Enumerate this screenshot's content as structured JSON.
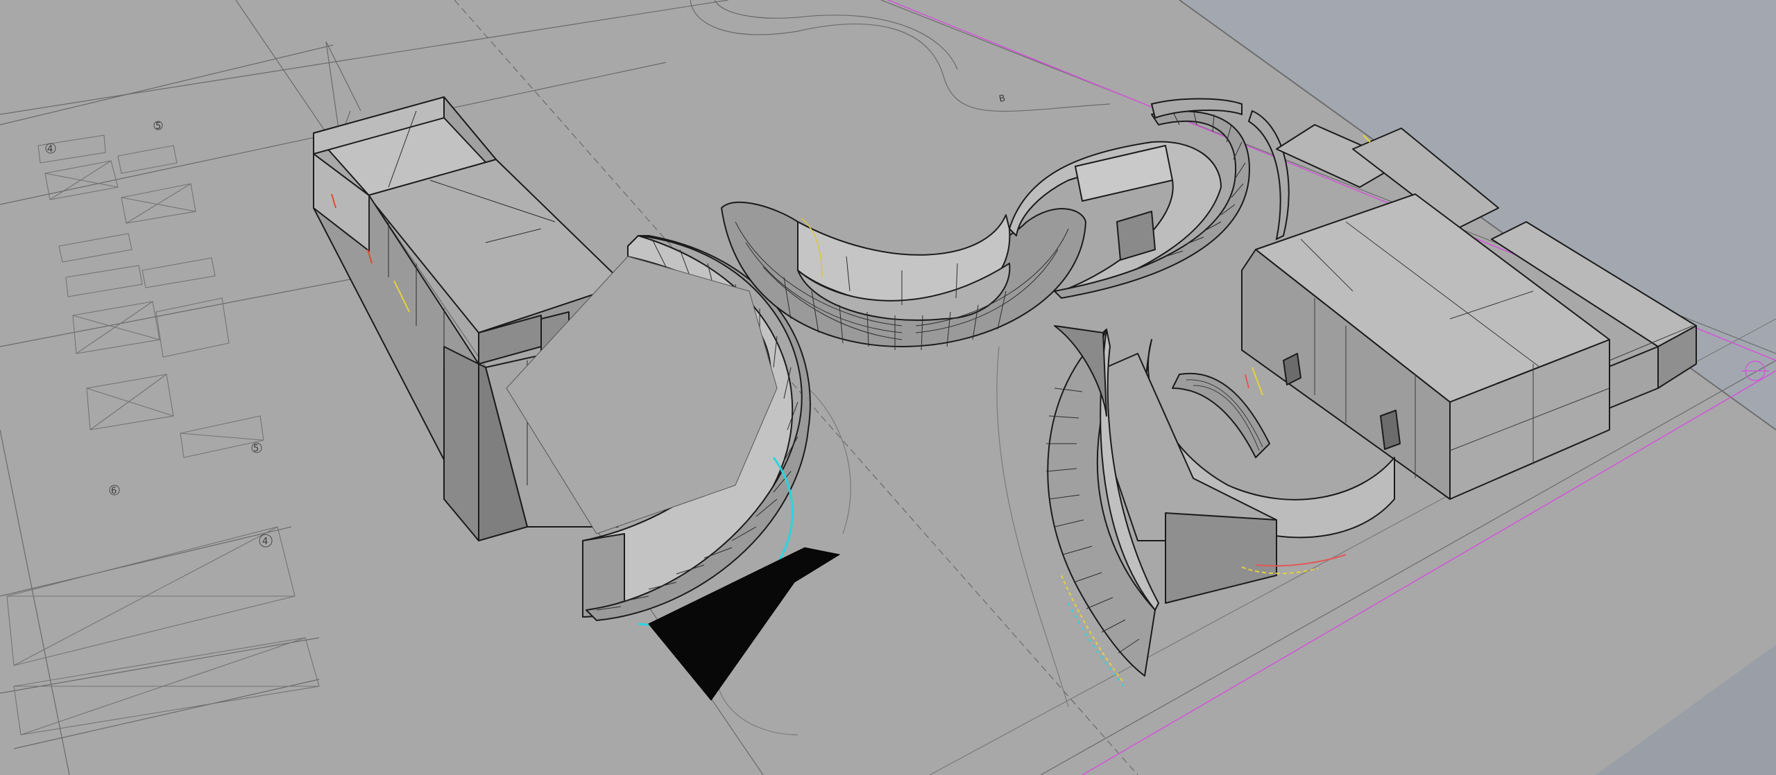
{
  "viewport": {
    "name": "Perspective",
    "background": "#9ea3ab",
    "ground_color": "#a7a7a7",
    "surface_light": "#c9c9c9",
    "surface_mid": "#b3b3b3",
    "surface_dark": "#8e8e8e",
    "edge_color": "#1a1a1a",
    "magenta_line": "#d058d6",
    "cyan_curve": "#29d4e0"
  },
  "annotations": {
    "site_label": "B",
    "grid_markers": [
      "4",
      "5",
      "6",
      "5",
      "4"
    ]
  }
}
